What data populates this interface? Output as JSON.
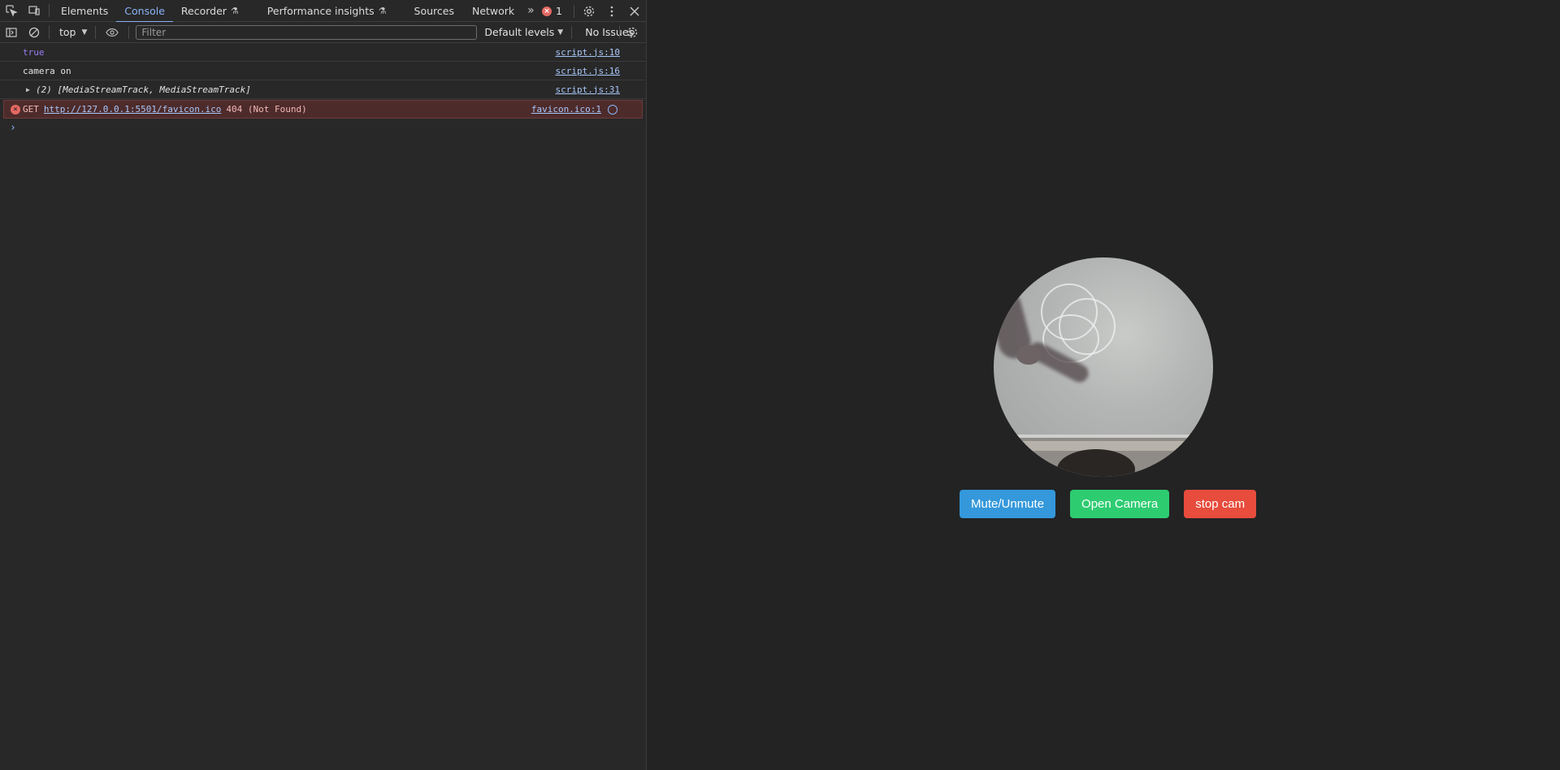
{
  "devtools": {
    "tabs": [
      {
        "label": "Elements"
      },
      {
        "label": "Console"
      },
      {
        "label": "Recorder"
      },
      {
        "label": "Performance insights"
      },
      {
        "label": "Sources"
      },
      {
        "label": "Network"
      }
    ],
    "active_tab": "Console",
    "error_count": "1",
    "toolbar": {
      "context": "top",
      "filter_placeholder": "Filter",
      "levels": "Default levels",
      "issues": "No Issues"
    },
    "messages": [
      {
        "text": "true",
        "source": "script.js:10"
      },
      {
        "text": "camera on",
        "source": "script.js:16"
      },
      {
        "text": "(2) [MediaStreamTrack, MediaStreamTrack]",
        "source": "script.js:31"
      }
    ],
    "error": {
      "method": "GET",
      "url": "http://127.0.0.1:5501/favicon.ico",
      "status": "404 (Not Found)",
      "source": "favicon.ico:1"
    },
    "prompt": "›"
  },
  "page": {
    "buttons": {
      "mute": "Mute/Unmute",
      "open": "Open Camera",
      "stop": "stop cam"
    },
    "colors": {
      "mute": "#3498db",
      "open": "#2ecc71",
      "stop": "#e74c3c",
      "background": "#232323"
    }
  },
  "icons": [
    "inspect-icon",
    "device-toolbar-icon",
    "flask-icon",
    "more-tabs-icon",
    "error-icon",
    "settings-icon",
    "kebab-menu-icon",
    "close-icon",
    "sidebar-icon",
    "clear-icon",
    "eye-icon",
    "network-icon"
  ]
}
